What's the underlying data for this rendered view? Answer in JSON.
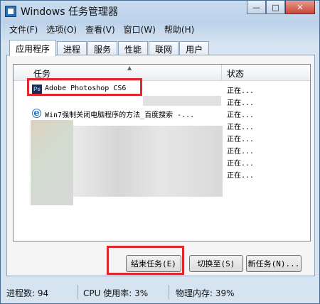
{
  "window": {
    "title": "Windows 任务管理器"
  },
  "title_buttons": {
    "minimize": "—",
    "maximize": "□",
    "close": "✕"
  },
  "menu": [
    "文件(F)",
    "选项(O)",
    "查看(V)",
    "窗口(W)",
    "帮助(H)"
  ],
  "tabs": [
    "应用程序",
    "进程",
    "服务",
    "性能",
    "联网",
    "用户"
  ],
  "task_list": {
    "headers": {
      "task": "任务",
      "status": "状态"
    },
    "rows": [
      {
        "label": "Adobe Photoshop CS6",
        "status": "正在...",
        "icon": "photoshop-icon",
        "icon_text": "Ps"
      },
      {
        "label": "",
        "status": "正在...",
        "icon": "",
        "icon_text": ""
      },
      {
        "label": "Win7强制关闭电脑程序的方法_百度搜索 -...",
        "status": "正在...",
        "icon": "ie-icon",
        "icon_text": "e"
      },
      {
        "label": "",
        "status": "正在...",
        "icon": "",
        "icon_text": ""
      },
      {
        "label": "",
        "status": "正在...",
        "icon": "",
        "icon_text": ""
      },
      {
        "label": "",
        "status": "正在...",
        "icon": "",
        "icon_text": ""
      },
      {
        "label": "",
        "status": "正在...",
        "icon": "",
        "icon_text": ""
      },
      {
        "label": "",
        "status": "正在...",
        "icon": "",
        "icon_text": ""
      }
    ]
  },
  "buttons": {
    "end_task": "结束任务(E)",
    "switch_to": "切换至(S)",
    "new_task": "新任务(N)..."
  },
  "status_bar": {
    "processes": "进程数: 94",
    "cpu": "CPU 使用率: 3%",
    "memory": "物理内存: 39%"
  },
  "colors": {
    "highlight": "#e0262f",
    "window_frame": "#bcd2ea",
    "photoshop_icon": "#1b2a4d"
  }
}
